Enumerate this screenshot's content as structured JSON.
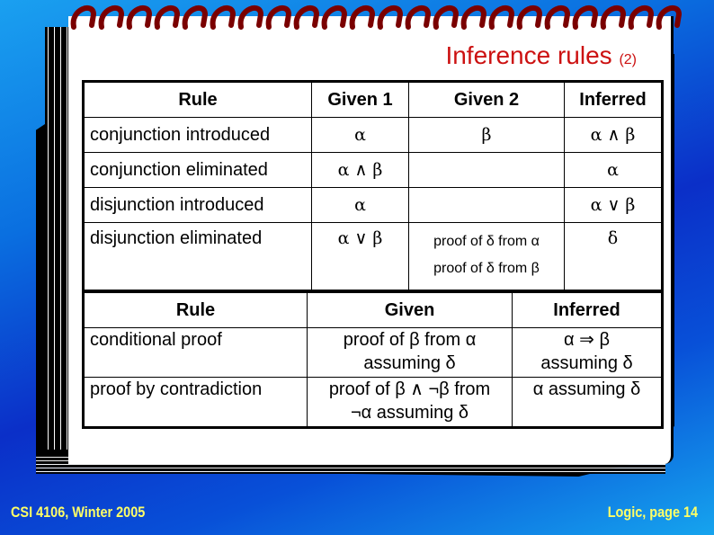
{
  "title": "Inference rules",
  "title_suffix": "(2)",
  "table1": {
    "headers": [
      "Rule",
      "Given 1",
      "Given 2",
      "Inferred"
    ],
    "rows": [
      {
        "rule": "conjunction introduced",
        "given1": "α",
        "given2": "β",
        "inferred": "α ∧ β"
      },
      {
        "rule": "conjunction eliminated",
        "given1": "α ∧ β",
        "given2": "",
        "inferred": "α"
      },
      {
        "rule": "disjunction introduced",
        "given1": "α",
        "given2": "",
        "inferred": "α ∨ β"
      },
      {
        "rule": "disjunction eliminated",
        "given1": "α ∨ β",
        "given2_lines": [
          "proof of δ from α",
          "proof of δ from β"
        ],
        "inferred": "δ"
      }
    ]
  },
  "table2": {
    "headers": [
      "Rule",
      "Given",
      "Inferred"
    ],
    "rows": [
      {
        "rule": "conditional proof",
        "given_lines": [
          "proof of β from α",
          "assuming δ"
        ],
        "inferred_lines": [
          "α ⇒ β",
          "assuming δ"
        ]
      },
      {
        "rule": "proof by contradiction",
        "given_lines": [
          "proof of β ∧ ¬β from",
          "¬α assuming δ"
        ],
        "inferred_lines": [
          "α assuming δ"
        ]
      }
    ]
  },
  "footer": {
    "left": "CSI 4106, Winter 2005",
    "right": "Logic, page 14"
  },
  "colors": {
    "title": "#cc1111",
    "footer": "#ffff66",
    "spiral": "#7a0000"
  }
}
